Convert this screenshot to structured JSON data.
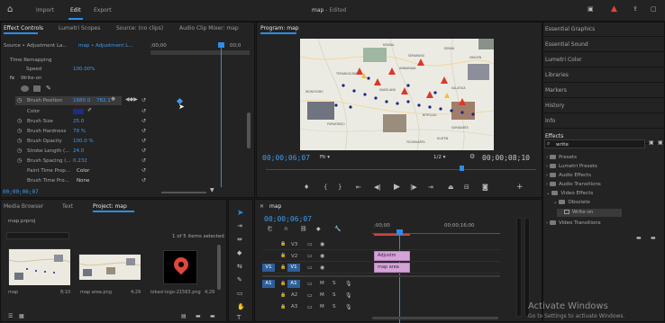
{
  "header": {
    "nav": [
      "Import",
      "Edit",
      "Export"
    ],
    "active": "Edit",
    "title": "map",
    "title_suffix": "- Edited"
  },
  "effect_controls": {
    "tabs": [
      "Effect Controls",
      "Lumetri Scopes",
      "Source: (no clips)",
      "Audio Clip Mixer: map"
    ],
    "source_label": "Source • Adjustment La...",
    "clip_label": "map • Adjustment L...",
    "ruler_start": ";00;00",
    "ruler_end": "00;0",
    "time_remapping": "Time Remapping",
    "speed_label": "Speed",
    "speed_value": "100.00%",
    "write_on": "Write-on",
    "props": [
      {
        "label": "Brush Position",
        "value": "1880.0",
        "value2": "782.1"
      },
      {
        "label": "Color",
        "value": ""
      },
      {
        "label": "Brush Size",
        "value": "25.0"
      },
      {
        "label": "Brush Hardness",
        "value": "79 %"
      },
      {
        "label": "Brush Opacity",
        "value": "100.0 %"
      },
      {
        "label": "Stroke Length (...",
        "value": "24.0"
      },
      {
        "label": "Brush Spacing (...",
        "value": "0.232"
      },
      {
        "label": "Paint Time Prop...",
        "value": "Color"
      },
      {
        "label": "Brush Time Pro...",
        "value": "None"
      }
    ],
    "timecode": "00;00;06;07"
  },
  "program": {
    "title": "Program: map",
    "timecode": "00;00;06;07",
    "fit": "Fit",
    "fraction": "1/2",
    "end_timecode": "00;00;08;10",
    "map_labels": [
      "SEMARANG",
      "MAGELANG",
      "SALATIGA",
      "PURWOREJO",
      "YOGYAKARTA",
      "SURAKARTA",
      "KLATEN",
      "BOYOLALI",
      "WONOSOBO",
      "KENDAL",
      "TEMANGGUNG",
      "SRAGEN",
      "DEMAK",
      "AMBARAWA"
    ]
  },
  "right_panels": [
    "Essential Graphics",
    "Essential Sound",
    "Lumetri Color",
    "Libraries",
    "Markers",
    "History",
    "Info",
    "Effects"
  ],
  "effects": {
    "search": "write",
    "tree": [
      {
        "label": "Presets",
        "level": 1
      },
      {
        "label": "Lumetri Presets",
        "level": 1
      },
      {
        "label": "Audio Effects",
        "level": 1
      },
      {
        "label": "Audio Transitions",
        "level": 1
      },
      {
        "label": "Video Effects",
        "level": 1
      },
      {
        "label": "Obsolete",
        "level": 2
      },
      {
        "label": "Write-on",
        "level": 3
      },
      {
        "label": "Video Transitions",
        "level": 1
      }
    ]
  },
  "project": {
    "tabs": [
      "Media Browser",
      "Text",
      "Project: map"
    ],
    "file": "map.prproj",
    "selection": "1 of 5 items selected",
    "items": [
      {
        "name": "map",
        "duration": "8;10"
      },
      {
        "name": "map area.png",
        "duration": "4;29"
      },
      {
        "name": "lokasi-logo-21563.png",
        "duration": "4;29"
      }
    ]
  },
  "timeline": {
    "title": "map",
    "timecode": "00;00;06;07",
    "ruler": [
      ";00;00",
      "00;00;16;00"
    ],
    "video_tracks": [
      "V3",
      "V2",
      "V1"
    ],
    "audio_tracks": [
      "A1",
      "A2",
      "A3"
    ],
    "source_patch_v": "V1",
    "source_patch_a": "A1",
    "clips": [
      {
        "label": "Adjustm",
        "track": "V2"
      },
      {
        "label": "map area",
        "track": "V1"
      }
    ]
  },
  "watermark": {
    "title": "Activate Windows",
    "subtitle": "Go to Settings to activate Windows."
  },
  "colors": {
    "accent": "#2d8ceb",
    "timecode": "#3d9bf0",
    "clip": "#d6a3d8",
    "alert": "#e0463b"
  }
}
